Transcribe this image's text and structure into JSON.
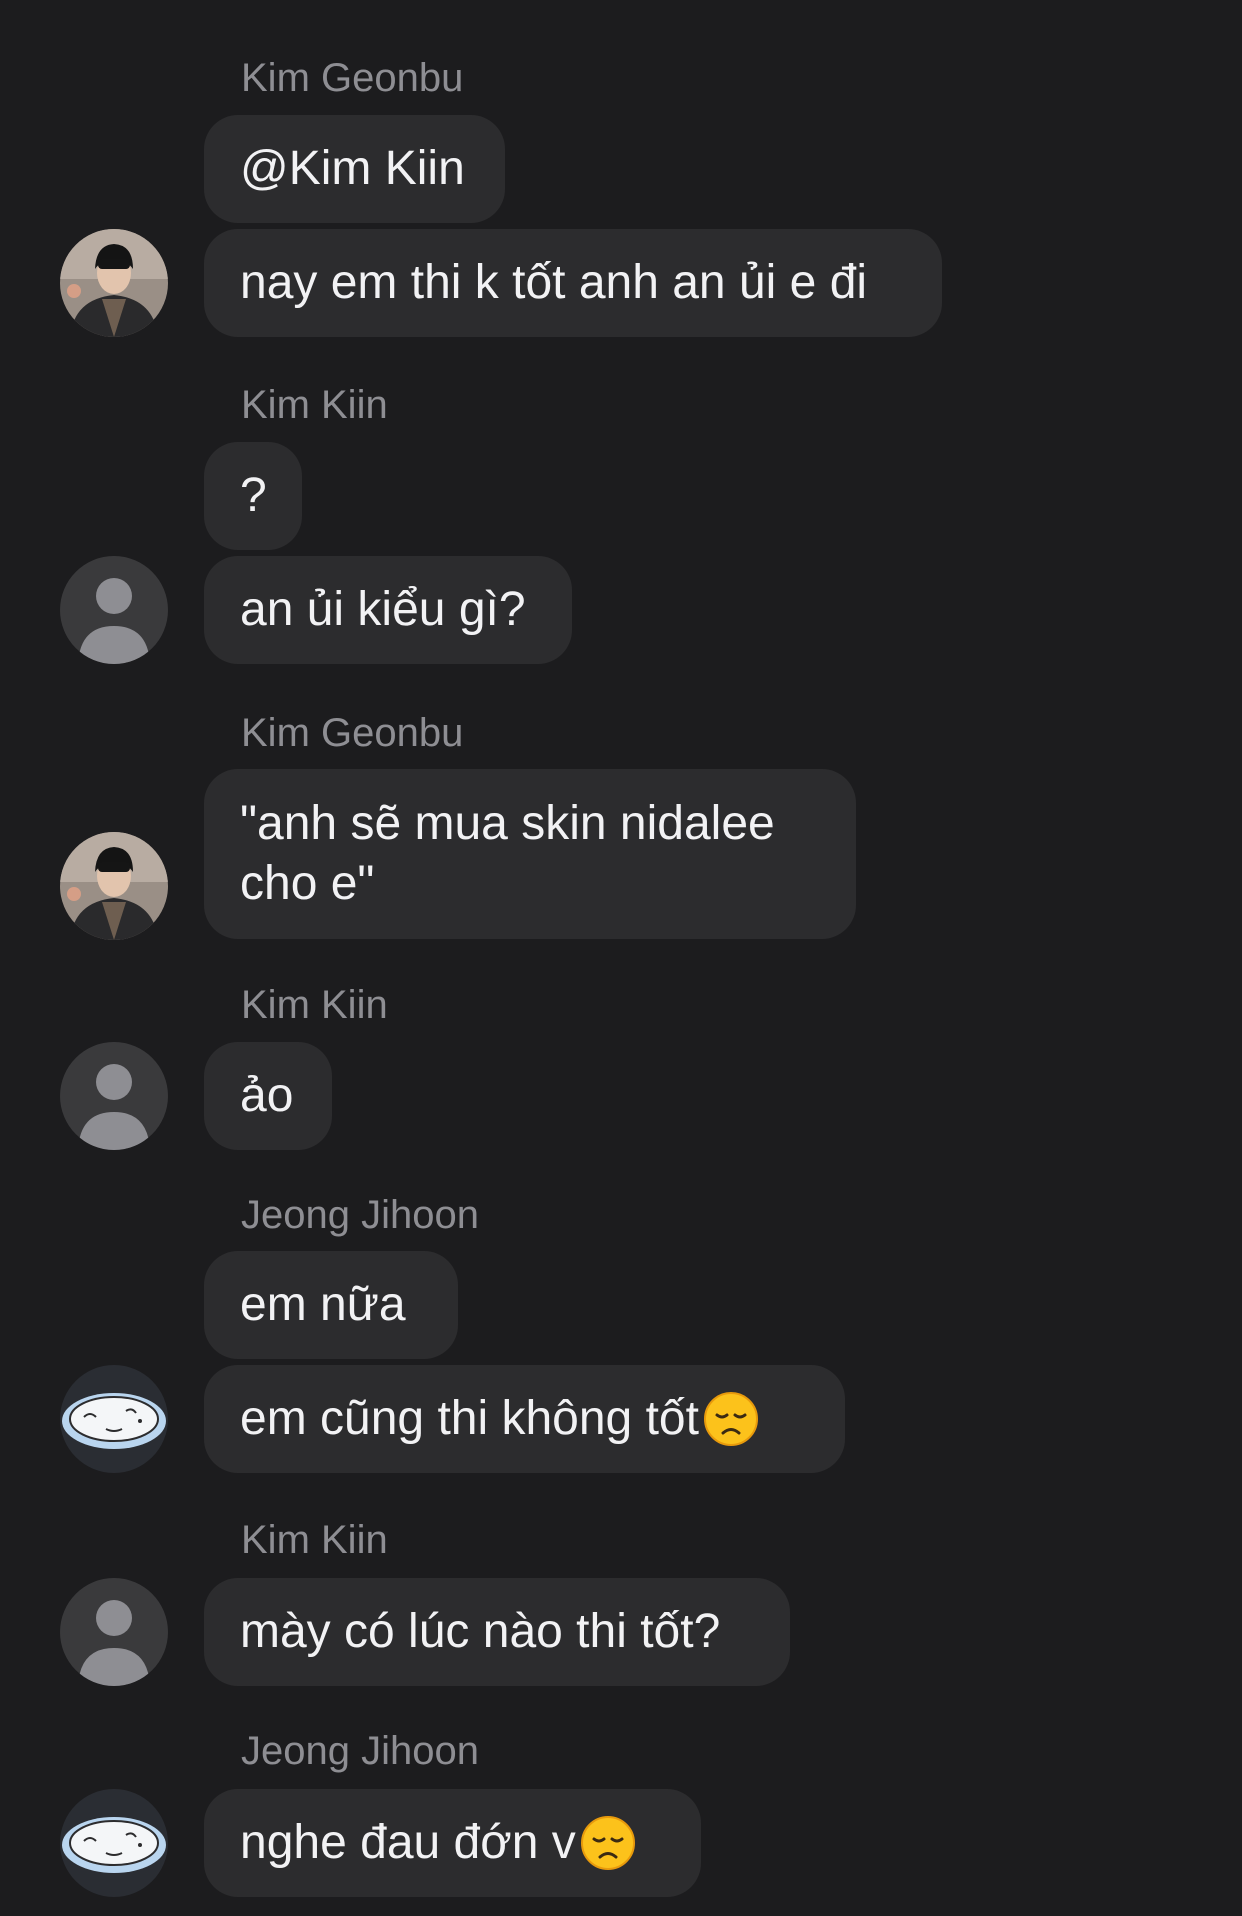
{
  "messages": [
    {
      "sender": "Kim Geonbu",
      "bubbles": [
        "@Kim Kiin",
        "nay em thi k tốt anh an ủi e đi"
      ]
    },
    {
      "sender": "Kim Kiin",
      "bubbles": [
        "?",
        "an ủi kiểu gì?"
      ]
    },
    {
      "sender": "Kim Geonbu",
      "bubbles": [
        "\"anh sẽ mua skin nidalee",
        "cho e\""
      ]
    },
    {
      "sender": "Kim Kiin",
      "bubbles": [
        "ảo"
      ]
    },
    {
      "sender": "Jeong Jihoon",
      "bubbles": [
        "em nữa",
        "em cũng thi không tốt"
      ]
    },
    {
      "sender": "Kim Kiin",
      "bubbles": [
        "mày có lúc nào thi tốt?"
      ]
    },
    {
      "sender": "Jeong Jihoon",
      "bubbles": [
        "nghe đau đớn v"
      ]
    }
  ],
  "icons": {
    "sad_emoji": "disappointed-face-emoji",
    "avatar_kim_geonbu": "photo-avatar",
    "avatar_kim_kiin": "default-person-avatar",
    "avatar_jeong_jihoon": "cartoon-egg-avatar"
  },
  "colors": {
    "background": "#1c1c1e",
    "bubble": "#2c2c2e",
    "sender_name": "#8e8e93",
    "text": "#f2f2f4"
  }
}
